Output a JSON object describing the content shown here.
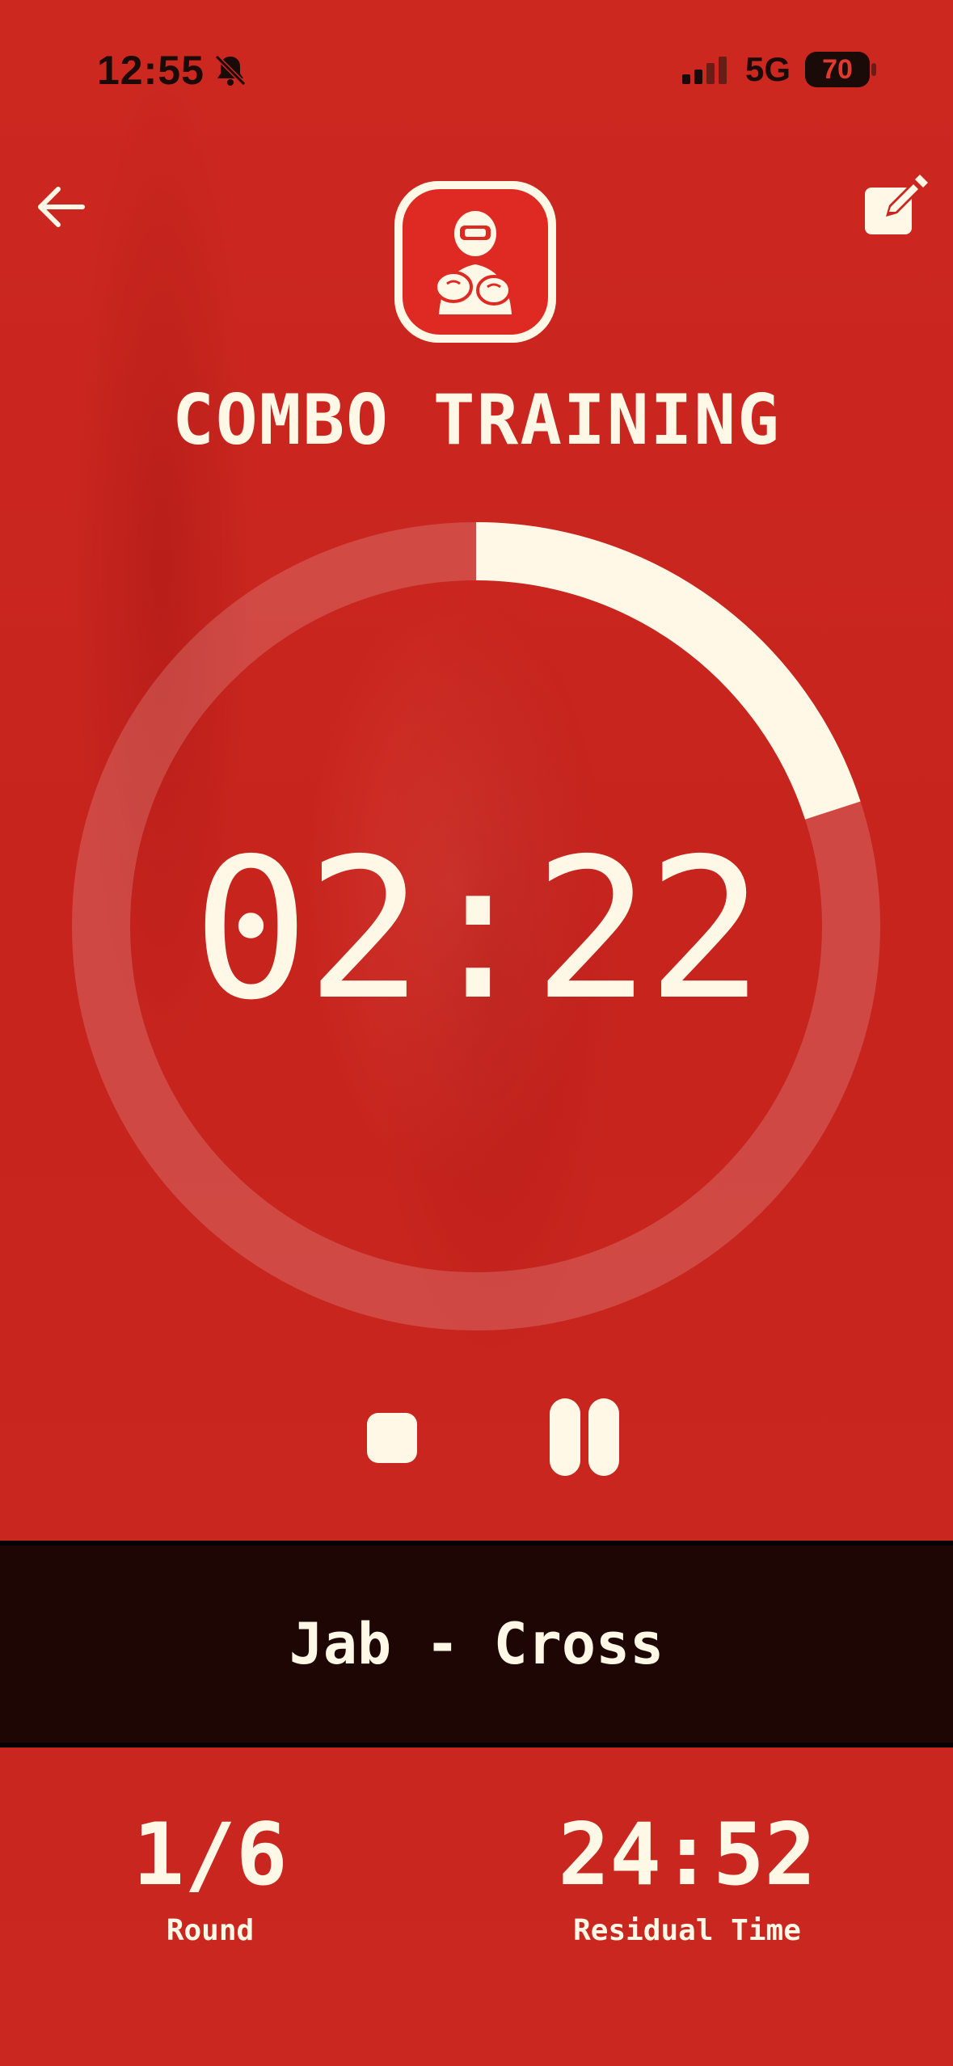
{
  "status_bar": {
    "time": "12:55",
    "network": "5G",
    "battery": "70",
    "icons": [
      "bell-slash-icon",
      "signal-icon",
      "battery-icon"
    ]
  },
  "header": {
    "back_icon": "arrow-left-icon",
    "edit_icon": "edit-icon",
    "logo_icon": "boxer-logo-icon",
    "title": "COMBO TRAINING"
  },
  "timer": {
    "value": "02:22",
    "progress_fraction": 0.2
  },
  "controls": {
    "stop_icon": "stop-icon",
    "pause_icon": "pause-icon"
  },
  "combo": {
    "text": "Jab - Cross"
  },
  "stats": {
    "round_value": "1/6",
    "round_label": "Round",
    "residual_value": "24:52",
    "residual_label": "Residual Time"
  },
  "colors": {
    "background": "#c8261f",
    "foreground": "#fff8e6",
    "panel": "#1e0605",
    "ring_track": "rgba(255,255,255,0.18)"
  }
}
